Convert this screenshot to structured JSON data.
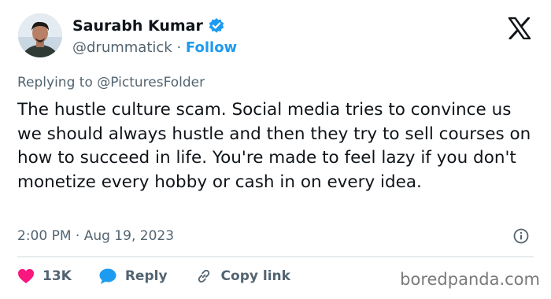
{
  "author": {
    "name": "Saurabh Kumar",
    "handle": "@drummatick",
    "separator": "·",
    "follow_label": "Follow"
  },
  "reply_context": {
    "prefix": "Replying to ",
    "handle": "@PicturesFolder"
  },
  "tweet": {
    "text": "The hustle culture scam. Social media tries to convince us we should always hustle and then they try to sell courses on how to succeed in life. You're made to feel lazy if you don't monetize every hobby or cash in on every idea.",
    "timestamp": "2:00 PM · Aug 19, 2023"
  },
  "actions": {
    "likes": "13K",
    "reply_label": "Reply",
    "copy_link_label": "Copy link"
  },
  "watermark": "boredpanda.com",
  "icons": {
    "verified": "verified-badge-icon",
    "logo": "x-logo-icon",
    "info": "info-icon",
    "like": "heart-icon",
    "reply": "speech-bubble-icon",
    "link": "link-icon"
  },
  "colors": {
    "accent": "#1d9bf0",
    "like": "#f91880",
    "text": "#0f1419",
    "muted": "#536471",
    "divider": "#cfd9de"
  }
}
